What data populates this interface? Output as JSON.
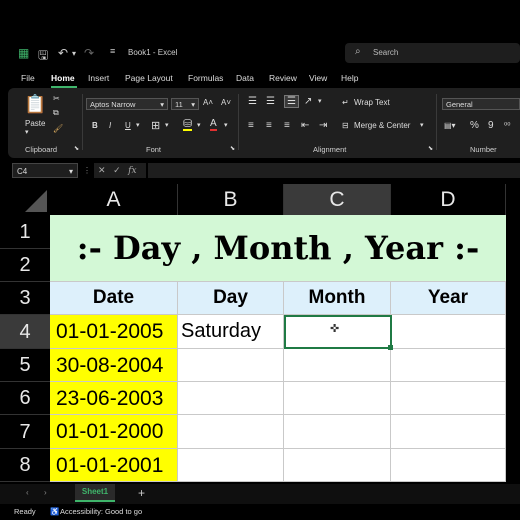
{
  "window": {
    "title": "Book1 - Excel",
    "search_placeholder": "Search"
  },
  "menu": [
    "File",
    "Home",
    "Insert",
    "Page Layout",
    "Formulas",
    "Data",
    "Review",
    "View",
    "Help"
  ],
  "ribbon": {
    "clipboard": {
      "paste": "Paste",
      "label": "Clipboard"
    },
    "font": {
      "name": "Aptos Narrow",
      "size": "11",
      "label": "Font",
      "bold": "B",
      "italic": "I",
      "underline": "U"
    },
    "alignment": {
      "wrap_text": "Wrap Text",
      "merge_center": "Merge & Center",
      "label": "Alignment"
    },
    "number": {
      "format": "General",
      "percent": "%",
      "comma": "9",
      "label": "Number"
    }
  },
  "formula_bar": {
    "name_box": "C4",
    "fx": "fx",
    "value": ""
  },
  "columns": [
    "A",
    "B",
    "C",
    "D"
  ],
  "rows": [
    "1",
    "2",
    "3",
    "4",
    "5",
    "6",
    "7",
    "8"
  ],
  "sheet": {
    "title": ":- Day , Month , Year :-",
    "headers": [
      "Date",
      "Day",
      "Month",
      "Year"
    ],
    "data": [
      [
        "01-01-2005",
        "Saturday",
        "",
        ""
      ],
      [
        "30-08-2004",
        "",
        "",
        ""
      ],
      [
        "23-06-2003",
        "",
        "",
        ""
      ],
      [
        "01-01-2000",
        "",
        "",
        ""
      ],
      [
        "01-01-2001",
        "",
        "",
        ""
      ]
    ]
  },
  "tabs": {
    "sheet_name": "Sheet1",
    "add": "+"
  },
  "status": {
    "ready": "Ready",
    "accessibility": "Accessibility: Good to go"
  },
  "colors": {
    "title_fill": "#d3f8d6",
    "header_fill": "#ddf0fb",
    "date_fill": "#ffff00",
    "accent": "#3fb56b"
  }
}
